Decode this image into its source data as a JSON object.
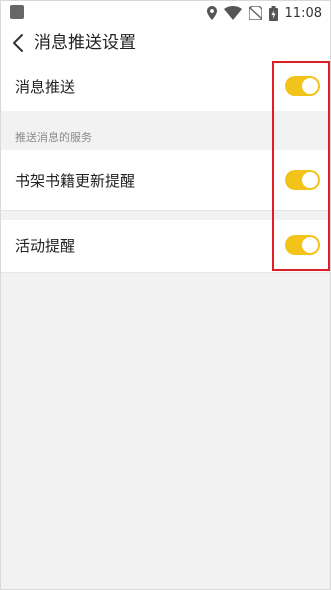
{
  "status_bar": {
    "time": "11:08",
    "icons": [
      "location-icon",
      "wifi-icon",
      "no-sim-icon",
      "battery-icon"
    ]
  },
  "header": {
    "back_icon": "chevron-left-icon",
    "title": "消息推送设置"
  },
  "main_setting": {
    "label": "消息推送",
    "enabled": true
  },
  "section": {
    "header": "推送消息的服务",
    "items": [
      {
        "label": "书架书籍更新提醒",
        "enabled": true
      },
      {
        "label": "活动提醒",
        "enabled": true
      }
    ]
  },
  "colors": {
    "toggle_on": "#f2c318",
    "highlight_box": "#e01f25",
    "background": "#f2f2f2"
  }
}
